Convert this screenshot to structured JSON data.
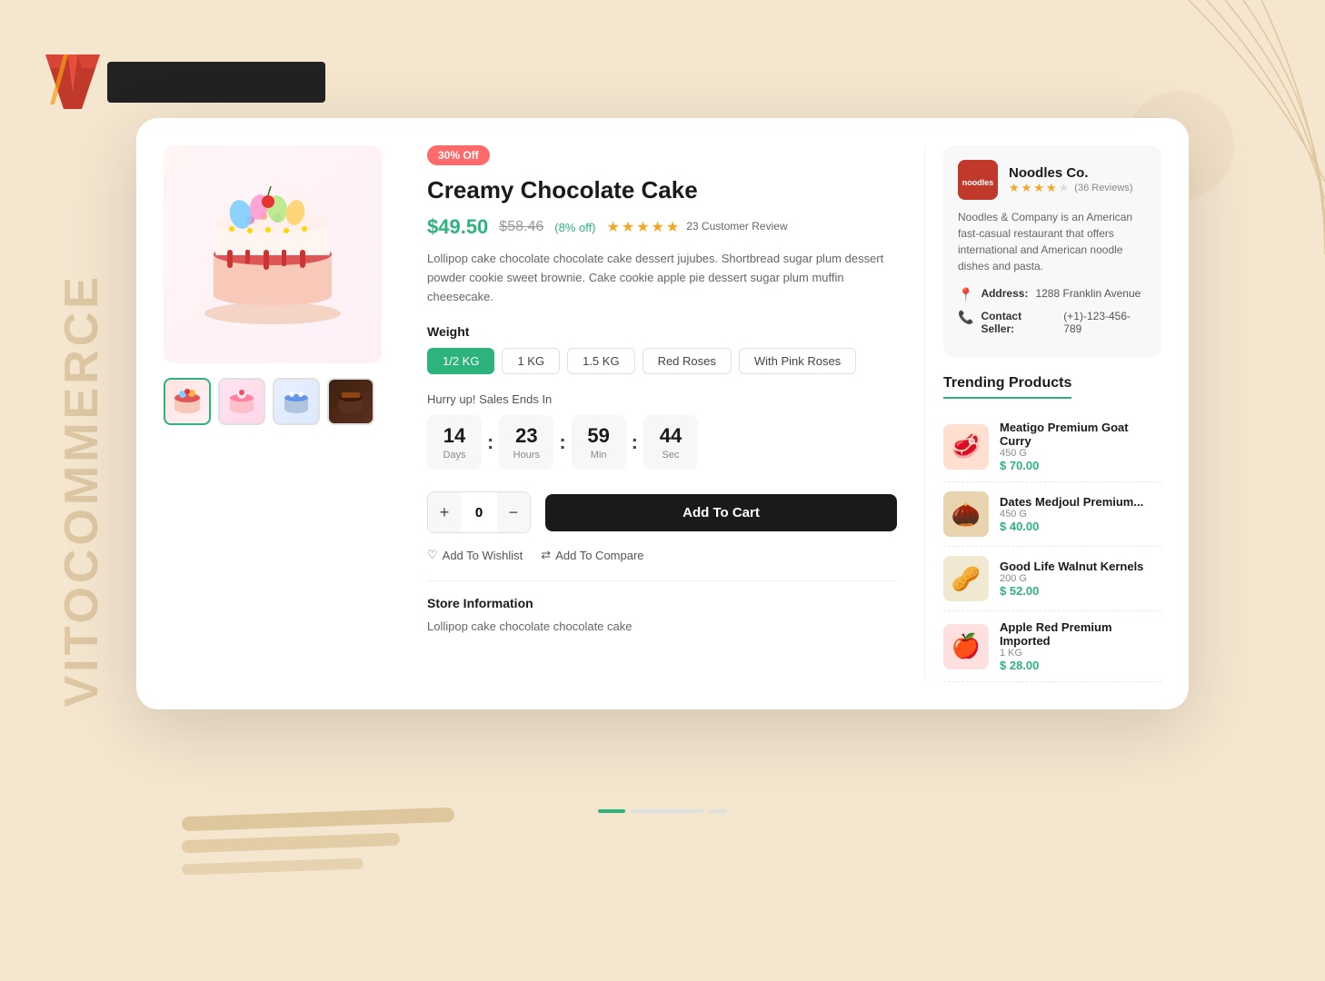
{
  "logo": {
    "v_letter": "V",
    "brand_name": "VITOCOMMERCE"
  },
  "background": {
    "side_label": "VITOCOMMERCE"
  },
  "product": {
    "discount_badge": "30% Off",
    "title": "Creamy Chocolate Cake",
    "price_main": "$49.50",
    "price_original": "$58.46",
    "price_discount_pct": "(8% off)",
    "rating": 4.5,
    "review_count": "23 Customer Review",
    "description": "Lollipop cake chocolate chocolate cake dessert jujubes. Shortbread sugar plum dessert powder cookie sweet brownie. Cake cookie apple pie dessert sugar plum muffin cheesecake.",
    "weight_label": "Weight",
    "weight_options": [
      "1/2 KG",
      "1 KG",
      "1.5 KG",
      "Red Roses",
      "With Pink Roses"
    ],
    "weight_selected": "1/2 KG",
    "countdown_label": "Hurry up! Sales Ends In",
    "countdown": {
      "days": "14",
      "hours": "23",
      "min": "59",
      "sec": "44",
      "days_label": "Days",
      "hours_label": "Hours",
      "min_label": "Min",
      "sec_label": "Sec"
    },
    "quantity": 0,
    "add_to_cart": "Add To Cart",
    "add_to_wishlist": "Add To Wishlist",
    "add_to_compare": "Add To Compare",
    "store_info_title": "Store Information",
    "store_info_text": "Lollipop cake chocolate chocolate cake"
  },
  "seller": {
    "name": "Noodles Co.",
    "logo_text": "noodles",
    "rating": 4,
    "review_count": "36 Reviews",
    "description": "Noodles & Company is an American fast-casual restaurant that offers international and American noodle dishes and pasta.",
    "address_label": "Address:",
    "address_value": "1288 Franklin Avenue",
    "contact_label": "Contact Seller:",
    "contact_value": "(+1)-123-456-789"
  },
  "trending": {
    "title": "Trending Products",
    "items": [
      {
        "name": "Meatigo Premium Goat Curry",
        "qty": "450 G",
        "price": "$ 70.00",
        "emoji": "🥩"
      },
      {
        "name": "Dates Medjoul Premium...",
        "qty": "450 G",
        "price": "$ 40.00",
        "emoji": "🌰"
      },
      {
        "name": "Good Life Walnut Kernels",
        "qty": "200 G",
        "price": "$ 52.00",
        "emoji": "🥜"
      },
      {
        "name": "Apple Red Premium Imported",
        "qty": "1 KG",
        "price": "$ 28.00",
        "emoji": "🍎"
      }
    ]
  }
}
